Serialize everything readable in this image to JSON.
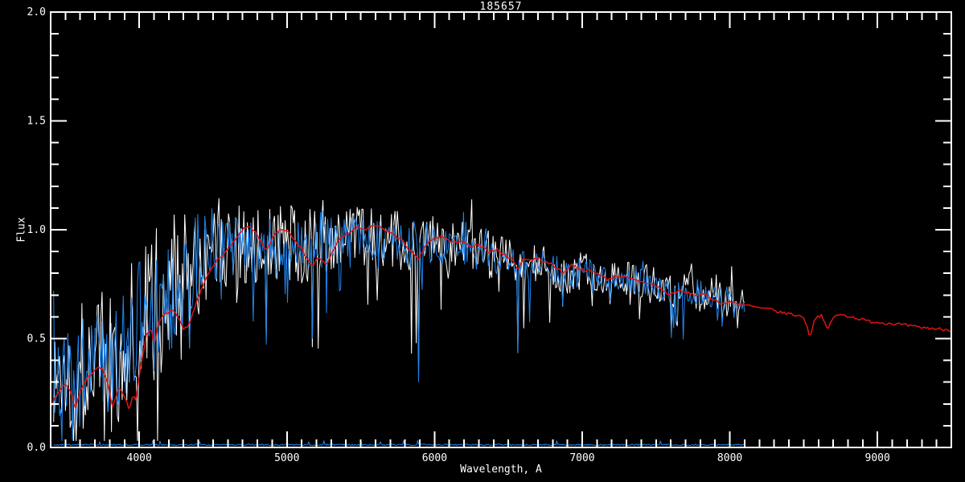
{
  "chart_data": {
    "type": "line",
    "title": "185657",
    "xlabel": "Wavelength, A",
    "ylabel": "Flux",
    "xlim": [
      3400,
      9500
    ],
    "ylim": [
      0.0,
      2.0
    ],
    "x_minor_step": 100,
    "y_minor_step": 0.1,
    "grid": false,
    "background_color": "#000000",
    "axis_color": "#ffffff",
    "x_ticks": [
      {
        "v": 4000,
        "label": "4000"
      },
      {
        "v": 5000,
        "label": "5000"
      },
      {
        "v": 6000,
        "label": "6000"
      },
      {
        "v": 7000,
        "label": "7000"
      },
      {
        "v": 8000,
        "label": "8000"
      },
      {
        "v": 9000,
        "label": "9000"
      }
    ],
    "y_ticks": [
      {
        "v": 0.0,
        "label": "0.0"
      },
      {
        "v": 0.5,
        "label": "0.5"
      },
      {
        "v": 1.0,
        "label": "1.0"
      },
      {
        "v": 1.5,
        "label": "1.5"
      },
      {
        "v": 2.0,
        "label": "2.0"
      }
    ],
    "envelope": [
      [
        3420,
        0.3
      ],
      [
        3500,
        0.35
      ],
      [
        3560,
        0.3
      ],
      [
        3620,
        0.38
      ],
      [
        3700,
        0.42
      ],
      [
        3780,
        0.38
      ],
      [
        3850,
        0.42
      ],
      [
        3920,
        0.5
      ],
      [
        3980,
        0.62
      ],
      [
        4050,
        0.68
      ],
      [
        4120,
        0.65
      ],
      [
        4200,
        0.7
      ],
      [
        4280,
        0.72
      ],
      [
        4360,
        0.85
      ],
      [
        4440,
        0.92
      ],
      [
        4520,
        0.92
      ],
      [
        4600,
        0.93
      ],
      [
        4700,
        0.92
      ],
      [
        4800,
        0.93
      ],
      [
        4900,
        0.94
      ],
      [
        5000,
        0.95
      ],
      [
        5100,
        0.93
      ],
      [
        5200,
        0.92
      ],
      [
        5300,
        0.95
      ],
      [
        5400,
        0.96
      ],
      [
        5500,
        0.97
      ],
      [
        5600,
        0.97
      ],
      [
        5700,
        0.95
      ],
      [
        5800,
        0.94
      ],
      [
        5900,
        0.92
      ],
      [
        6000,
        0.94
      ],
      [
        6100,
        0.93
      ],
      [
        6200,
        0.91
      ],
      [
        6300,
        0.89
      ],
      [
        6400,
        0.88
      ],
      [
        6500,
        0.86
      ],
      [
        6563,
        0.84
      ],
      [
        6650,
        0.84
      ],
      [
        6750,
        0.83
      ],
      [
        6870,
        0.8
      ],
      [
        7000,
        0.81
      ],
      [
        7100,
        0.8
      ],
      [
        7200,
        0.78
      ],
      [
        7300,
        0.77
      ],
      [
        7400,
        0.76
      ],
      [
        7500,
        0.74
      ],
      [
        7600,
        0.71
      ],
      [
        7700,
        0.72
      ],
      [
        7800,
        0.71
      ],
      [
        7900,
        0.69
      ],
      [
        8000,
        0.68
      ],
      [
        8100,
        0.67
      ]
    ],
    "sigma": [
      [
        3420,
        0.2
      ],
      [
        3600,
        0.22
      ],
      [
        3800,
        0.24
      ],
      [
        3950,
        0.25
      ],
      [
        4100,
        0.25
      ],
      [
        4250,
        0.26
      ],
      [
        4400,
        0.2
      ],
      [
        4550,
        0.15
      ],
      [
        4700,
        0.13
      ],
      [
        4900,
        0.12
      ],
      [
        5100,
        0.13
      ],
      [
        5300,
        0.11
      ],
      [
        5500,
        0.1
      ],
      [
        5700,
        0.1
      ],
      [
        5900,
        0.11
      ],
      [
        6100,
        0.08
      ],
      [
        6300,
        0.08
      ],
      [
        6500,
        0.08
      ],
      [
        6700,
        0.07
      ],
      [
        6900,
        0.07
      ],
      [
        7100,
        0.06
      ],
      [
        7300,
        0.06
      ],
      [
        7500,
        0.06
      ],
      [
        7700,
        0.065
      ],
      [
        7900,
        0.06
      ],
      [
        8100,
        0.055
      ]
    ],
    "absorption_dips": [
      [
        3933,
        0.25
      ],
      [
        3968,
        0.3
      ],
      [
        4101,
        0.35
      ],
      [
        4340,
        0.4
      ],
      [
        4861,
        0.5
      ],
      [
        5175,
        0.45
      ],
      [
        5890,
        0.28
      ],
      [
        6563,
        0.38
      ],
      [
        6870,
        0.6
      ],
      [
        7190,
        0.62
      ],
      [
        7605,
        0.5
      ],
      [
        7640,
        0.55
      ],
      [
        7950,
        0.55
      ],
      [
        8025,
        0.58
      ]
    ],
    "series": [
      {
        "name": "observed-spectrum-raw",
        "kind": "noisy",
        "color": "#ffffff",
        "x_range": [
          3420,
          8100
        ],
        "step": 8,
        "seed": 1337,
        "sigma_scale": 1.45,
        "width": 1
      },
      {
        "name": "observed-spectrum-smoothed",
        "kind": "noisy",
        "color": "#1f85ee",
        "x_range": [
          3420,
          8100
        ],
        "step": 8,
        "seed": 20241,
        "sigma_scale": 1.0,
        "width": 1
      },
      {
        "name": "sky-error-spectrum",
        "kind": "flat-noisy",
        "color": "#1f85ee",
        "x_range": [
          3420,
          8100
        ],
        "step": 6,
        "seed": 555,
        "level": 0.012,
        "noise": 0.004,
        "width": 1
      },
      {
        "name": "template-spectrum",
        "kind": "smooth",
        "color": "#e01212",
        "step": 12,
        "seed": 7,
        "jitter": 0.007,
        "width": 1.5,
        "points": [
          [
            3400,
            0.19
          ],
          [
            3450,
            0.25
          ],
          [
            3490,
            0.29
          ],
          [
            3530,
            0.27
          ],
          [
            3565,
            0.18
          ],
          [
            3600,
            0.26
          ],
          [
            3650,
            0.32
          ],
          [
            3700,
            0.36
          ],
          [
            3740,
            0.37
          ],
          [
            3780,
            0.31
          ],
          [
            3820,
            0.18
          ],
          [
            3860,
            0.28
          ],
          [
            3900,
            0.24
          ],
          [
            3933,
            0.17
          ],
          [
            3955,
            0.24
          ],
          [
            3975,
            0.21
          ],
          [
            4010,
            0.38
          ],
          [
            4050,
            0.52
          ],
          [
            4080,
            0.55
          ],
          [
            4101,
            0.47
          ],
          [
            4130,
            0.57
          ],
          [
            4170,
            0.61
          ],
          [
            4220,
            0.63
          ],
          [
            4260,
            0.6
          ],
          [
            4300,
            0.54
          ],
          [
            4340,
            0.57
          ],
          [
            4380,
            0.65
          ],
          [
            4430,
            0.74
          ],
          [
            4470,
            0.8
          ],
          [
            4510,
            0.85
          ],
          [
            4550,
            0.87
          ],
          [
            4600,
            0.91
          ],
          [
            4650,
            0.95
          ],
          [
            4700,
            1.0
          ],
          [
            4750,
            1.02
          ],
          [
            4800,
            0.97
          ],
          [
            4861,
            0.9
          ],
          [
            4900,
            0.96
          ],
          [
            4950,
            1.0
          ],
          [
            5000,
            1.0
          ],
          [
            5050,
            0.96
          ],
          [
            5100,
            0.91
          ],
          [
            5170,
            0.83
          ],
          [
            5210,
            0.87
          ],
          [
            5270,
            0.84
          ],
          [
            5330,
            0.93
          ],
          [
            5380,
            0.97
          ],
          [
            5430,
            0.99
          ],
          [
            5480,
            1.01
          ],
          [
            5540,
            1.0
          ],
          [
            5600,
            1.02
          ],
          [
            5660,
            1.0
          ],
          [
            5720,
            0.98
          ],
          [
            5780,
            0.95
          ],
          [
            5840,
            0.9
          ],
          [
            5890,
            0.86
          ],
          [
            5940,
            0.93
          ],
          [
            6000,
            0.96
          ],
          [
            6060,
            0.97
          ],
          [
            6120,
            0.94
          ],
          [
            6180,
            0.95
          ],
          [
            6240,
            0.92
          ],
          [
            6300,
            0.93
          ],
          [
            6360,
            0.9
          ],
          [
            6420,
            0.91
          ],
          [
            6480,
            0.88
          ],
          [
            6540,
            0.86
          ],
          [
            6563,
            0.81
          ],
          [
            6600,
            0.87
          ],
          [
            6650,
            0.86
          ],
          [
            6700,
            0.87
          ],
          [
            6750,
            0.85
          ],
          [
            6800,
            0.84
          ],
          [
            6870,
            0.8
          ],
          [
            6930,
            0.84
          ],
          [
            6990,
            0.82
          ],
          [
            7050,
            0.81
          ],
          [
            7110,
            0.8
          ],
          [
            7170,
            0.77
          ],
          [
            7230,
            0.79
          ],
          [
            7290,
            0.78
          ],
          [
            7350,
            0.77
          ],
          [
            7410,
            0.76
          ],
          [
            7470,
            0.75
          ],
          [
            7530,
            0.73
          ],
          [
            7590,
            0.7
          ],
          [
            7650,
            0.72
          ],
          [
            7710,
            0.71
          ],
          [
            7770,
            0.7
          ],
          [
            7830,
            0.7
          ],
          [
            7890,
            0.68
          ],
          [
            7950,
            0.66
          ],
          [
            8010,
            0.67
          ],
          [
            8070,
            0.66
          ],
          [
            8130,
            0.65
          ],
          [
            8200,
            0.64
          ],
          [
            8270,
            0.635
          ],
          [
            8340,
            0.62
          ],
          [
            8400,
            0.615
          ],
          [
            8460,
            0.605
          ],
          [
            8500,
            0.6
          ],
          [
            8542,
            0.51
          ],
          [
            8580,
            0.6
          ],
          [
            8620,
            0.605
          ],
          [
            8662,
            0.54
          ],
          [
            8700,
            0.6
          ],
          [
            8760,
            0.61
          ],
          [
            8820,
            0.6
          ],
          [
            8880,
            0.59
          ],
          [
            8940,
            0.58
          ],
          [
            9000,
            0.575
          ],
          [
            9080,
            0.57
          ],
          [
            9160,
            0.565
          ],
          [
            9240,
            0.555
          ],
          [
            9320,
            0.55
          ],
          [
            9400,
            0.545
          ],
          [
            9500,
            0.54
          ]
        ]
      }
    ]
  }
}
